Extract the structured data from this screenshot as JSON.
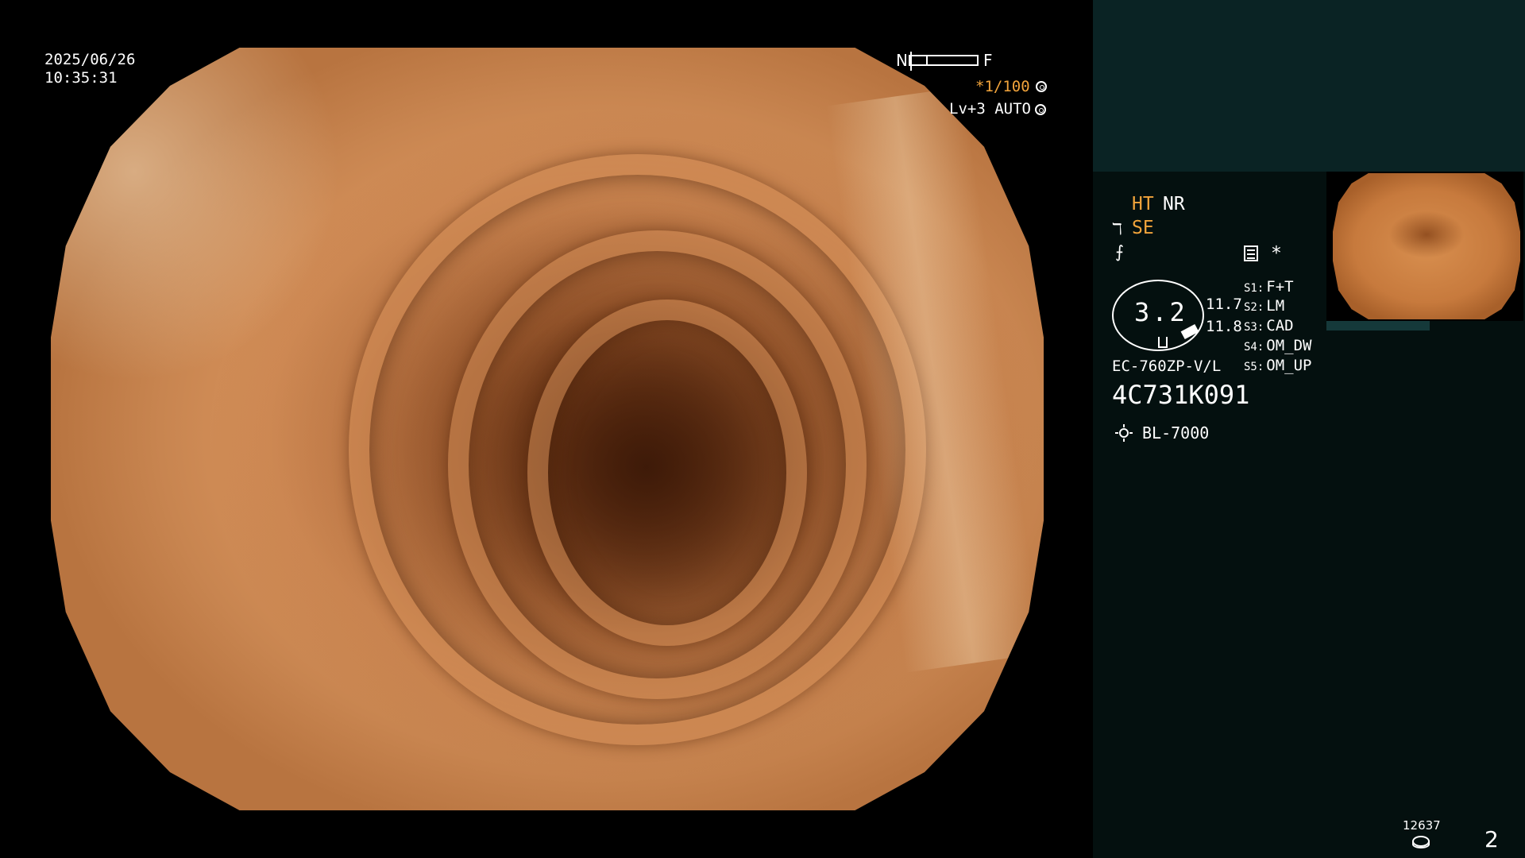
{
  "overlay": {
    "date": "2025/06/26",
    "time": "10:35:31",
    "near_label": "N",
    "far_label": "F",
    "shutter": "*1/100",
    "level": "Lv+3 AUTO"
  },
  "panel": {
    "ht": "HT",
    "nr": "NR",
    "se_symbol": "ℸ",
    "se": "SE",
    "edge_symbol": "⨍",
    "star": "*",
    "dial_value": "3.2",
    "value1": "11.7",
    "value2": "11.8",
    "switches": [
      {
        "key": "S1:",
        "value": "F+T"
      },
      {
        "key": "S2:",
        "value": "LM"
      },
      {
        "key": "S3:",
        "value": "CAD"
      },
      {
        "key": "S4:",
        "value": "OM_DW"
      },
      {
        "key": "S5:",
        "value": "OM_UP"
      }
    ],
    "scope_model": "EC-760ZP-V/L",
    "serial": "4C731K091",
    "light_source": "BL-7000",
    "counter": "12637",
    "page_number": "2"
  },
  "colors": {
    "accent_orange": "#f2a43b",
    "panel_dark": "#04100f",
    "panel_top": "#0a2324"
  },
  "icons": [
    "shutter-icon",
    "auto-exposure-icon",
    "memo-icon",
    "light-source-icon",
    "disk-icon"
  ]
}
